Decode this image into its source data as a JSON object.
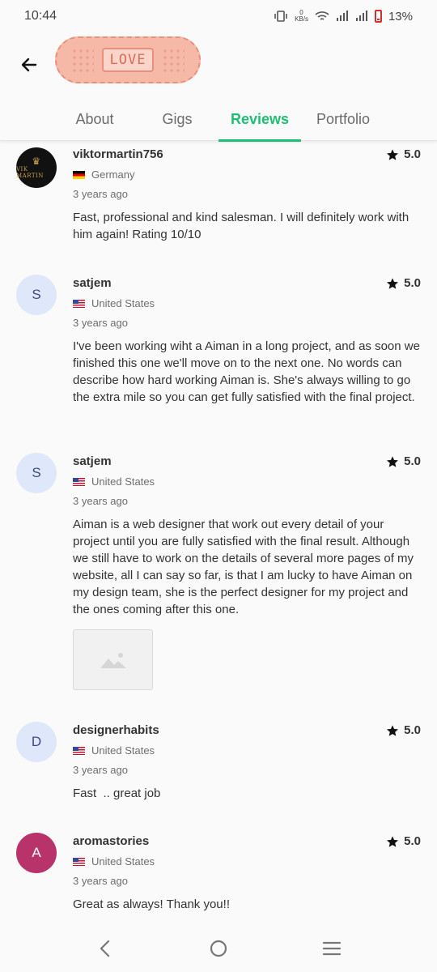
{
  "status": {
    "time": "10:44",
    "net_speed": "0",
    "net_unit": "KB/s",
    "battery": "13%"
  },
  "header": {
    "sticker_text": "LOVE"
  },
  "tabs": [
    {
      "label": "About"
    },
    {
      "label": "Gigs"
    },
    {
      "label": "Reviews"
    },
    {
      "label": "Portfolio"
    }
  ],
  "active_tab": "Reviews",
  "colors": {
    "accent": "#1dbf73",
    "avatar_light": "#dfe8fb",
    "avatar_pink": "#b8336a"
  },
  "reviews": [
    {
      "username": "viktormartin756",
      "avatar_logo_text": "VIK MARTIN",
      "country": "Germany",
      "time": "3 years ago",
      "rating": "5.0",
      "text": "Fast, professional and kind salesman. I will definitely work with him again! Rating 10/10"
    },
    {
      "username": "satjem",
      "avatar_letter": "S",
      "country": "United States",
      "time": "3 years ago",
      "rating": "5.0",
      "text": "I've been working wiht a Aiman in a long project, and as soon we finished this one we'll move on to the next one. No words can describe how hard working Aiman is. She's always willing to go the extra mile so you can get fully satisfied with the final project."
    },
    {
      "username": "satjem",
      "avatar_letter": "S",
      "country": "United States",
      "time": "3 years ago",
      "rating": "5.0",
      "text": "Aiman is a web designer that work out every detail of your project until you are fully satisfied with the final result. Although we still have to work on the details of several more pages of my website, all I can say so far, is that I am lucky to have Aiman on my design team, she is the perfect designer for my project and the ones coming after this one."
    },
    {
      "username": "designerhabits",
      "avatar_letter": "D",
      "country": "United States",
      "time": "3 years ago",
      "rating": "5.0",
      "text": "Fast  .. great job"
    },
    {
      "username": "aromastories",
      "avatar_letter": "A",
      "country": "United States",
      "time": "3 years ago",
      "rating": "5.0",
      "text": "Great as always! Thank you!!"
    }
  ]
}
